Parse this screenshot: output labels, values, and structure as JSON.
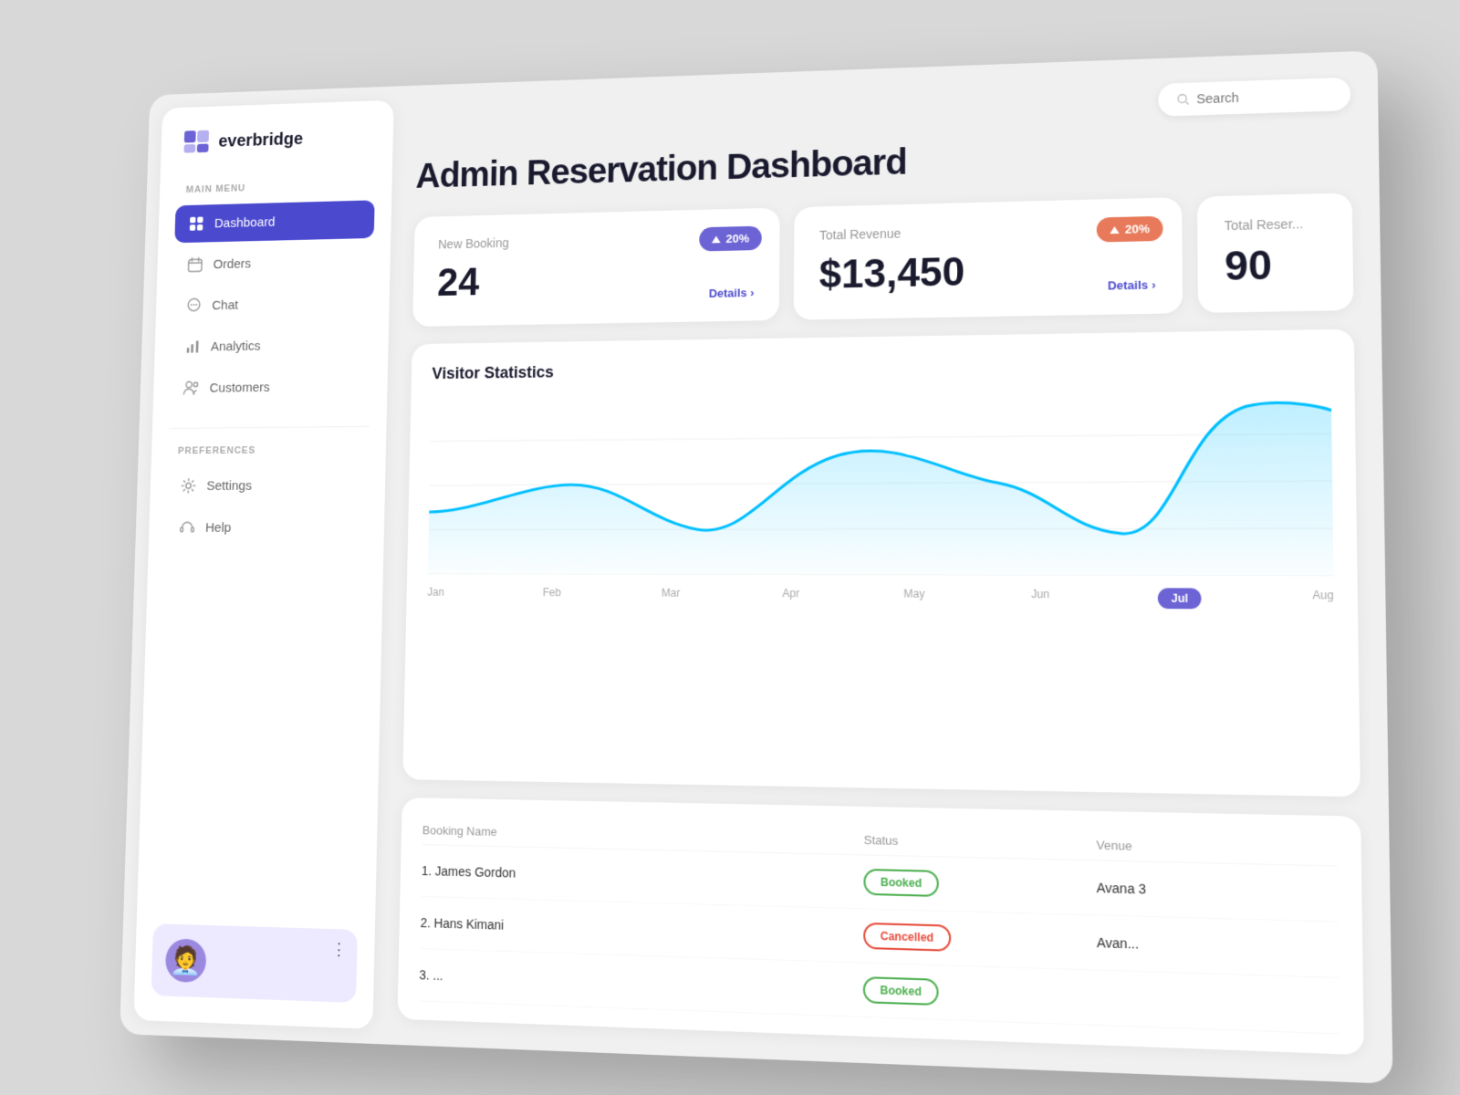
{
  "app": {
    "name": "everbridge",
    "title": "Admin Reservation Dashboard"
  },
  "search": {
    "placeholder": "Search"
  },
  "sidebar": {
    "menu_label": "MAIN MENU",
    "pref_label": "PREFERENCES",
    "nav_items": [
      {
        "id": "dashboard",
        "label": "Dashboard",
        "active": true,
        "icon": "grid"
      },
      {
        "id": "orders",
        "label": "Orders",
        "active": false,
        "icon": "calendar"
      },
      {
        "id": "chat",
        "label": "Chat",
        "active": false,
        "icon": "chat"
      },
      {
        "id": "analytics",
        "label": "Analytics",
        "active": false,
        "icon": "bar-chart"
      },
      {
        "id": "customers",
        "label": "Customers",
        "active": false,
        "icon": "users"
      }
    ],
    "pref_items": [
      {
        "id": "settings",
        "label": "Settings",
        "icon": "gear"
      },
      {
        "id": "help",
        "label": "Help",
        "icon": "headphone"
      }
    ],
    "user": {
      "emoji": "🧑‍💼"
    }
  },
  "stats": {
    "new_booking": {
      "label": "New Booking",
      "value": "24",
      "badge": "20%",
      "details": "Details ›"
    },
    "total_revenue": {
      "label": "Total Revenue",
      "value": "$13,450",
      "badge": "20%",
      "details": "Details ›"
    },
    "total_reservations": {
      "label": "Total Reser...",
      "value": "90"
    }
  },
  "chart": {
    "title": "Visitor Statistics",
    "x_labels": [
      "Jan",
      "Feb",
      "Mar",
      "Apr",
      "May",
      "Jun",
      "Jul",
      "Aug"
    ],
    "active_month": "Jul"
  },
  "table": {
    "headers": [
      "Booking Name",
      "Status",
      "Venue"
    ],
    "rows": [
      {
        "name": "1. James Gordon",
        "status": "Booked",
        "status_type": "booked",
        "venue": "Avana 3"
      },
      {
        "name": "2. Hans Kimani",
        "status": "Cancelled",
        "status_type": "cancelled",
        "venue": "Avan..."
      },
      {
        "name": "3. ...",
        "status": "Booked",
        "status_type": "booked",
        "venue": ""
      }
    ]
  }
}
